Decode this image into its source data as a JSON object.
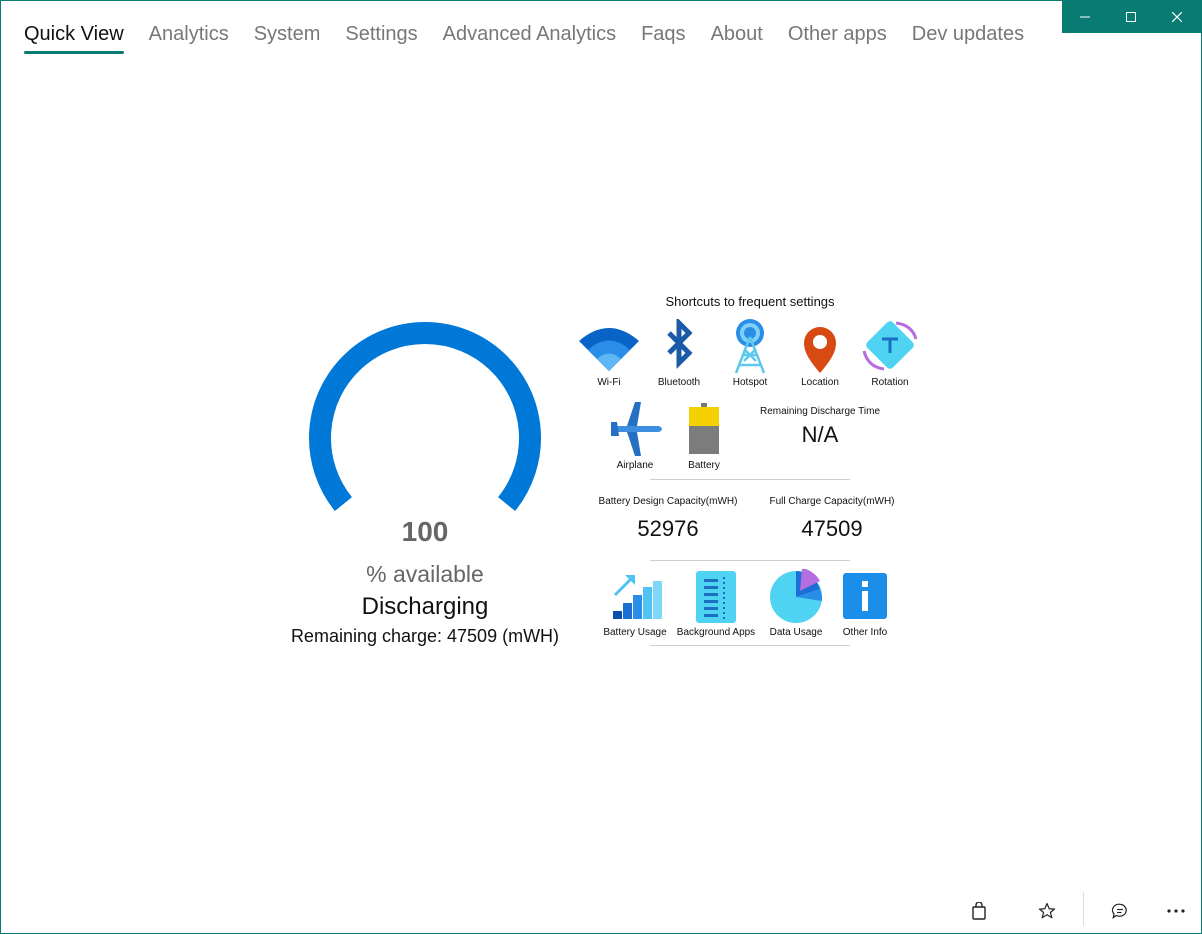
{
  "nav": {
    "tabs": [
      {
        "label": "Quick View"
      },
      {
        "label": "Analytics"
      },
      {
        "label": "System"
      },
      {
        "label": "Settings"
      },
      {
        "label": "Advanced Analytics"
      },
      {
        "label": "Faqs"
      },
      {
        "label": "About"
      },
      {
        "label": "Other apps"
      },
      {
        "label": "Dev updates"
      }
    ]
  },
  "gauge": {
    "percent": 100,
    "value_label": "100",
    "unit_label": "% available",
    "status": "Discharging",
    "remaining_charge": "Remaining charge: 47509 (mWH)",
    "color": "#0078d7"
  },
  "shortcuts": {
    "title": "Shortcuts to frequent settings",
    "row1": [
      {
        "label": "Wi-Fi",
        "icon": "wifi-icon"
      },
      {
        "label": "Bluetooth",
        "icon": "bluetooth-icon"
      },
      {
        "label": "Hotspot",
        "icon": "hotspot-icon"
      },
      {
        "label": "Location",
        "icon": "location-icon"
      },
      {
        "label": "Rotation",
        "icon": "rotation-icon"
      }
    ],
    "row2": [
      {
        "label": "Airplane",
        "icon": "airplane-icon"
      },
      {
        "label": "Battery",
        "icon": "battery-icon"
      }
    ],
    "row3": [
      {
        "label": "Battery Usage",
        "icon": "battery-usage-icon"
      },
      {
        "label": "Background Apps",
        "icon": "background-apps-icon"
      },
      {
        "label": "Data Usage",
        "icon": "data-usage-icon"
      },
      {
        "label": "Other Info",
        "icon": "info-icon"
      }
    ]
  },
  "stats": {
    "discharge_time_label": "Remaining Discharge Time",
    "discharge_time_value": "N/A",
    "design_capacity_label": "Battery Design Capacity(mWH)",
    "design_capacity_value": "52976",
    "full_charge_label": "Full Charge Capacity(mWH)",
    "full_charge_value": "47509"
  },
  "accent_color": "#087b73"
}
